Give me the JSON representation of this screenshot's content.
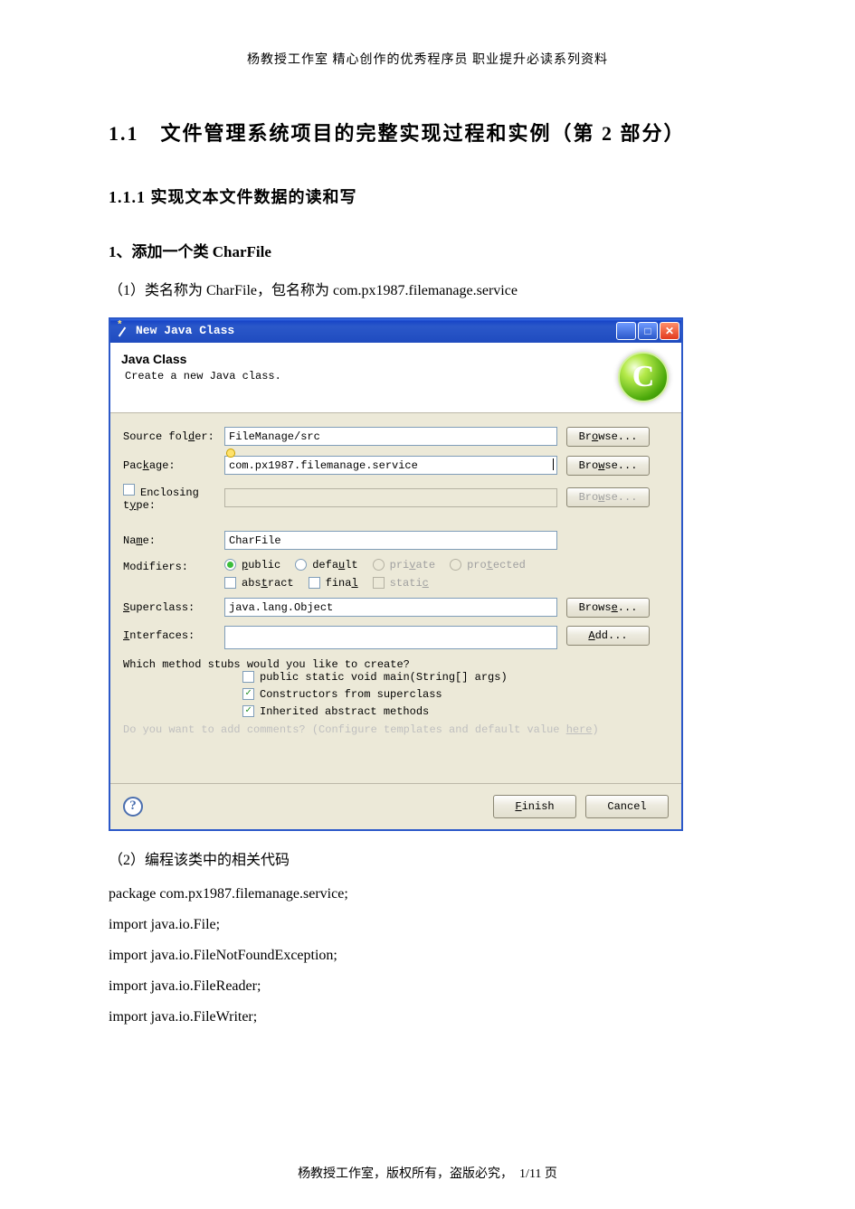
{
  "header": "杨教授工作室  精心创作的优秀程序员  职业提升必读系列资料",
  "h1": "1.1　文件管理系统项目的完整实现过程和实例（第 2 部分）",
  "h2": "1.1.1 实现文本文件数据的读和写",
  "h3": "1、添加一个类 CharFile",
  "para1": "（1）类名称为 CharFile，包名称为 com.px1987.filemanage.service",
  "dialog": {
    "title": "New Java Class",
    "banner_title": "Java Class",
    "banner_sub": "Create a new Java class.",
    "banner_icon_letter": "C",
    "labels": {
      "source_folder": "Source folder:",
      "package": "Package:",
      "enclosing": "Enclosing type:",
      "name": "Name:",
      "modifiers": "Modifiers:",
      "superclass": "Superclass:",
      "interfaces": "Interfaces:"
    },
    "values": {
      "source_folder": "FileManage/src",
      "package": "com.px1987.filemanage.service",
      "enclosing": "",
      "name": "CharFile",
      "superclass": "java.lang.Object",
      "interfaces": ""
    },
    "buttons": {
      "browse": "Browse...",
      "add": "Add...",
      "finish": "Finish",
      "cancel": "Cancel"
    },
    "modifiers": {
      "public": "public",
      "default": "default",
      "private": "private",
      "protected": "protected",
      "abstract": "abstract",
      "final": "final",
      "static": "static"
    },
    "stubs": {
      "question": "Which method stubs would you like to create?",
      "main": "public static void main(String[] args)",
      "constructors": "Constructors from superclass",
      "inherited": "Inherited abstract methods"
    },
    "faded": "Do you want to add comments? (Configure templates and default value here)"
  },
  "para2": "（2）编程该类中的相关代码",
  "code": {
    "l1": "package  com.px1987.filemanage.service;",
    "l2": "import  java.io.File;",
    "l3": "import  java.io.FileNotFoundException;",
    "l4": "import  java.io.FileReader;",
    "l5": "import  java.io.FileWriter;"
  },
  "footer": "杨教授工作室，版权所有，盗版必究，　1/11 页"
}
